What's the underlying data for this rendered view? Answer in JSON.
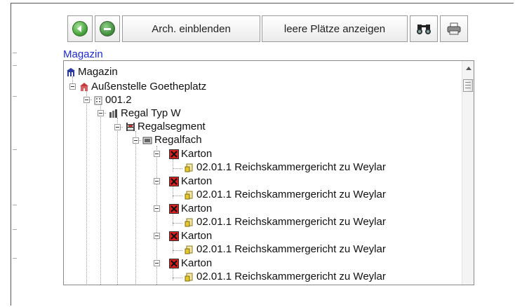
{
  "toolbar": {
    "back_label": "",
    "forward_label": "",
    "show_archive_label": "Arch. einblenden",
    "show_empty_label": "leere Plätze anzeigen"
  },
  "section_label": "Magazin",
  "tree": {
    "root": "Magazin",
    "branch": "Außenstelle Goetheplatz",
    "room": "001.2",
    "shelf_type": "Regal Typ W",
    "segment": "Regalsegment",
    "compartment": "Regalfach",
    "boxes": [
      {
        "label": "Karton",
        "child": "02.01.1 Reichskammergericht zu Weylar"
      },
      {
        "label": "Karton",
        "child": "02.01.1 Reichskammergericht zu Weylar"
      },
      {
        "label": "Karton",
        "child": "02.01.1 Reichskammergericht zu Weylar"
      },
      {
        "label": "Karton",
        "child": "02.01.1 Reichskammergericht zu Weylar"
      },
      {
        "label": "Karton",
        "child": "02.01.1 Reichskammergericht zu Weylar"
      }
    ]
  },
  "colors": {
    "section_label": "#1d2bd1",
    "box_icon": "#d61f1f"
  }
}
